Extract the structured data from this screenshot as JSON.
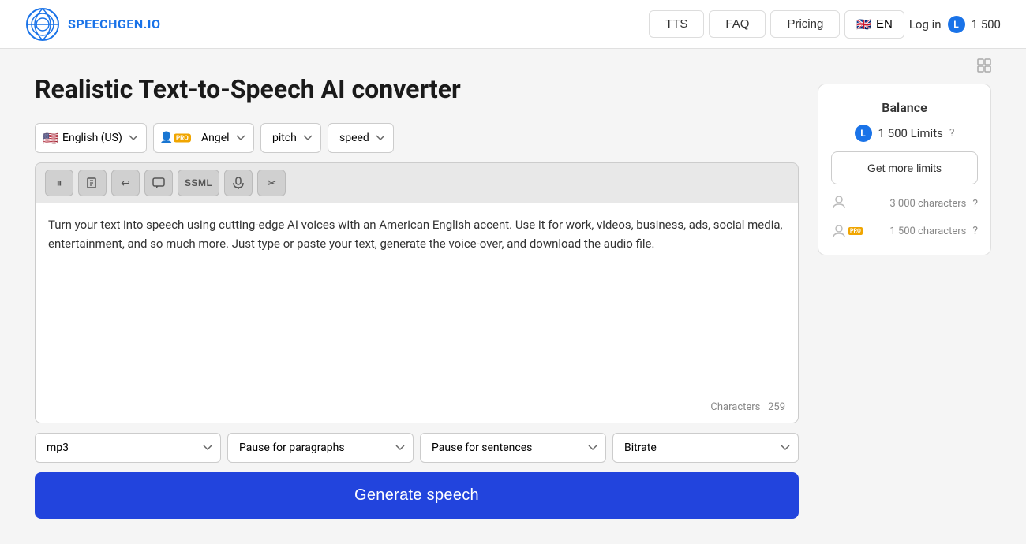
{
  "header": {
    "logo_text": "SPEECHGEN.IO",
    "nav": {
      "tts_label": "TTS",
      "faq_label": "FAQ",
      "pricing_label": "Pricing",
      "lang_label": "EN",
      "login_label": "Log in",
      "balance_amount": "1 500",
      "balance_icon": "L"
    }
  },
  "main": {
    "page_title": "Realistic Text-to-Speech AI converter",
    "controls": {
      "language": {
        "value": "English (US)",
        "flag": "🇺🇸"
      },
      "voice": {
        "value": "Angel",
        "pro": "PRO"
      },
      "pitch_label": "pitch",
      "speed_label": "speed"
    },
    "toolbar": {
      "pause_icon": "⏸",
      "brush_icon": "🖊",
      "undo_icon": "↩",
      "bubble_icon": "💬",
      "ssml_label": "SSML",
      "mic_icon": "🎤",
      "scissors_icon": "✂"
    },
    "text_content": "Turn your text into speech using cutting-edge AI voices with an American English accent. Use it for work, videos, business, ads, social media, entertainment, and so much more. Just type or paste your text, generate the voice-over, and download the audio file.",
    "char_count_label": "Characters",
    "char_count": "259",
    "output": {
      "format": "mp3",
      "pause_paragraphs": "Pause for paragraphs",
      "pause_sentences": "Pause for sentences",
      "bitrate": "Bitrate"
    },
    "generate_btn_label": "Generate speech"
  },
  "sidebar": {
    "balance_title": "Balance",
    "balance_icon": "L",
    "balance_amount": "1 500 Limits",
    "get_more_label": "Get more limits",
    "free_limit": "3 000 characters",
    "pro_limit": "1 500 characters",
    "help_icon": "?"
  }
}
